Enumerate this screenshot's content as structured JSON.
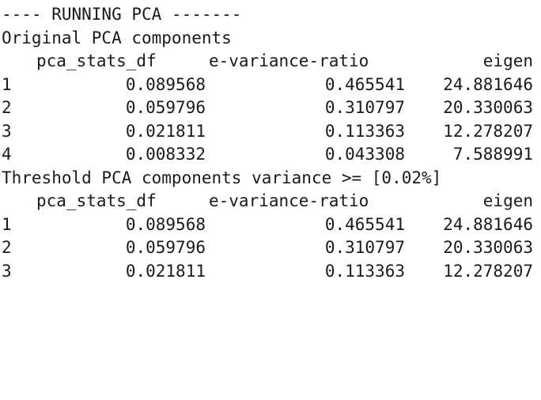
{
  "console": {
    "banner": "---- RUNNING PCA -------",
    "sections": [
      {
        "title": "Original PCA components",
        "headers": [
          "pca_stats_df",
          "e-variance-ratio",
          "eigen"
        ],
        "rows": [
          {
            "idx": "1",
            "stats": "0.089568",
            "ratio": "0.465541",
            "eigen": "24.881646"
          },
          {
            "idx": "2",
            "stats": "0.059796",
            "ratio": "0.310797",
            "eigen": "20.330063"
          },
          {
            "idx": "3",
            "stats": "0.021811",
            "ratio": "0.113363",
            "eigen": "12.278207"
          },
          {
            "idx": "4",
            "stats": "0.008332",
            "ratio": "0.043308",
            "eigen": "7.588991"
          }
        ]
      },
      {
        "title": "Threshold PCA components variance >= [0.02%]",
        "headers": [
          "pca_stats_df",
          "e-variance-ratio",
          "eigen"
        ],
        "rows": [
          {
            "idx": "1",
            "stats": "0.089568",
            "ratio": "0.465541",
            "eigen": "24.881646"
          },
          {
            "idx": "2",
            "stats": "0.059796",
            "ratio": "0.310797",
            "eigen": "20.330063"
          },
          {
            "idx": "3",
            "stats": "0.021811",
            "ratio": "0.113363",
            "eigen": "12.278207"
          }
        ]
      }
    ]
  }
}
